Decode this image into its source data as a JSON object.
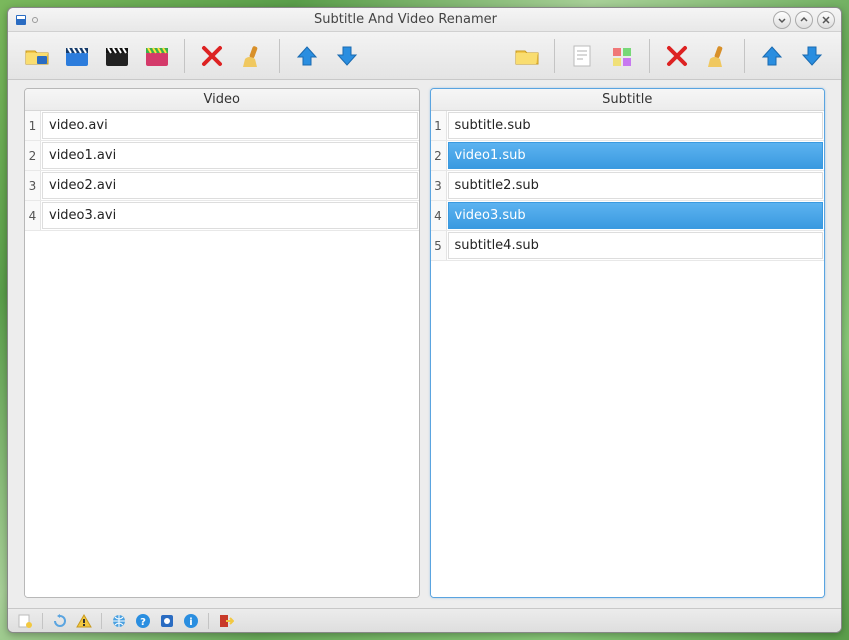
{
  "window": {
    "title": "Subtitle And Video Renamer"
  },
  "panels": {
    "video": {
      "header": "Video",
      "rows": [
        {
          "num": "1",
          "name": "video.avi",
          "selected": false
        },
        {
          "num": "2",
          "name": "video1.avi",
          "selected": false
        },
        {
          "num": "3",
          "name": "video2.avi",
          "selected": false
        },
        {
          "num": "4",
          "name": "video3.avi",
          "selected": false
        }
      ]
    },
    "subtitle": {
      "header": "Subtitle",
      "rows": [
        {
          "num": "1",
          "name": "subtitle.sub",
          "selected": false
        },
        {
          "num": "2",
          "name": "video1.sub",
          "selected": true
        },
        {
          "num": "3",
          "name": "subtitle2.sub",
          "selected": false
        },
        {
          "num": "4",
          "name": "video3.sub",
          "selected": true
        },
        {
          "num": "5",
          "name": "subtitle4.sub",
          "selected": false
        }
      ]
    }
  },
  "icons": {
    "folder": "folder-icon",
    "clapper_blue": "clapper-blue-icon",
    "clapper_black": "clapper-black-icon",
    "clapper_rainbow": "clapper-rainbow-icon",
    "delete": "delete-icon",
    "broom": "broom-icon",
    "up": "arrow-up-icon",
    "down": "arrow-down-icon",
    "folder2": "folder-icon",
    "doc": "document-icon",
    "palette": "palette-icon"
  }
}
